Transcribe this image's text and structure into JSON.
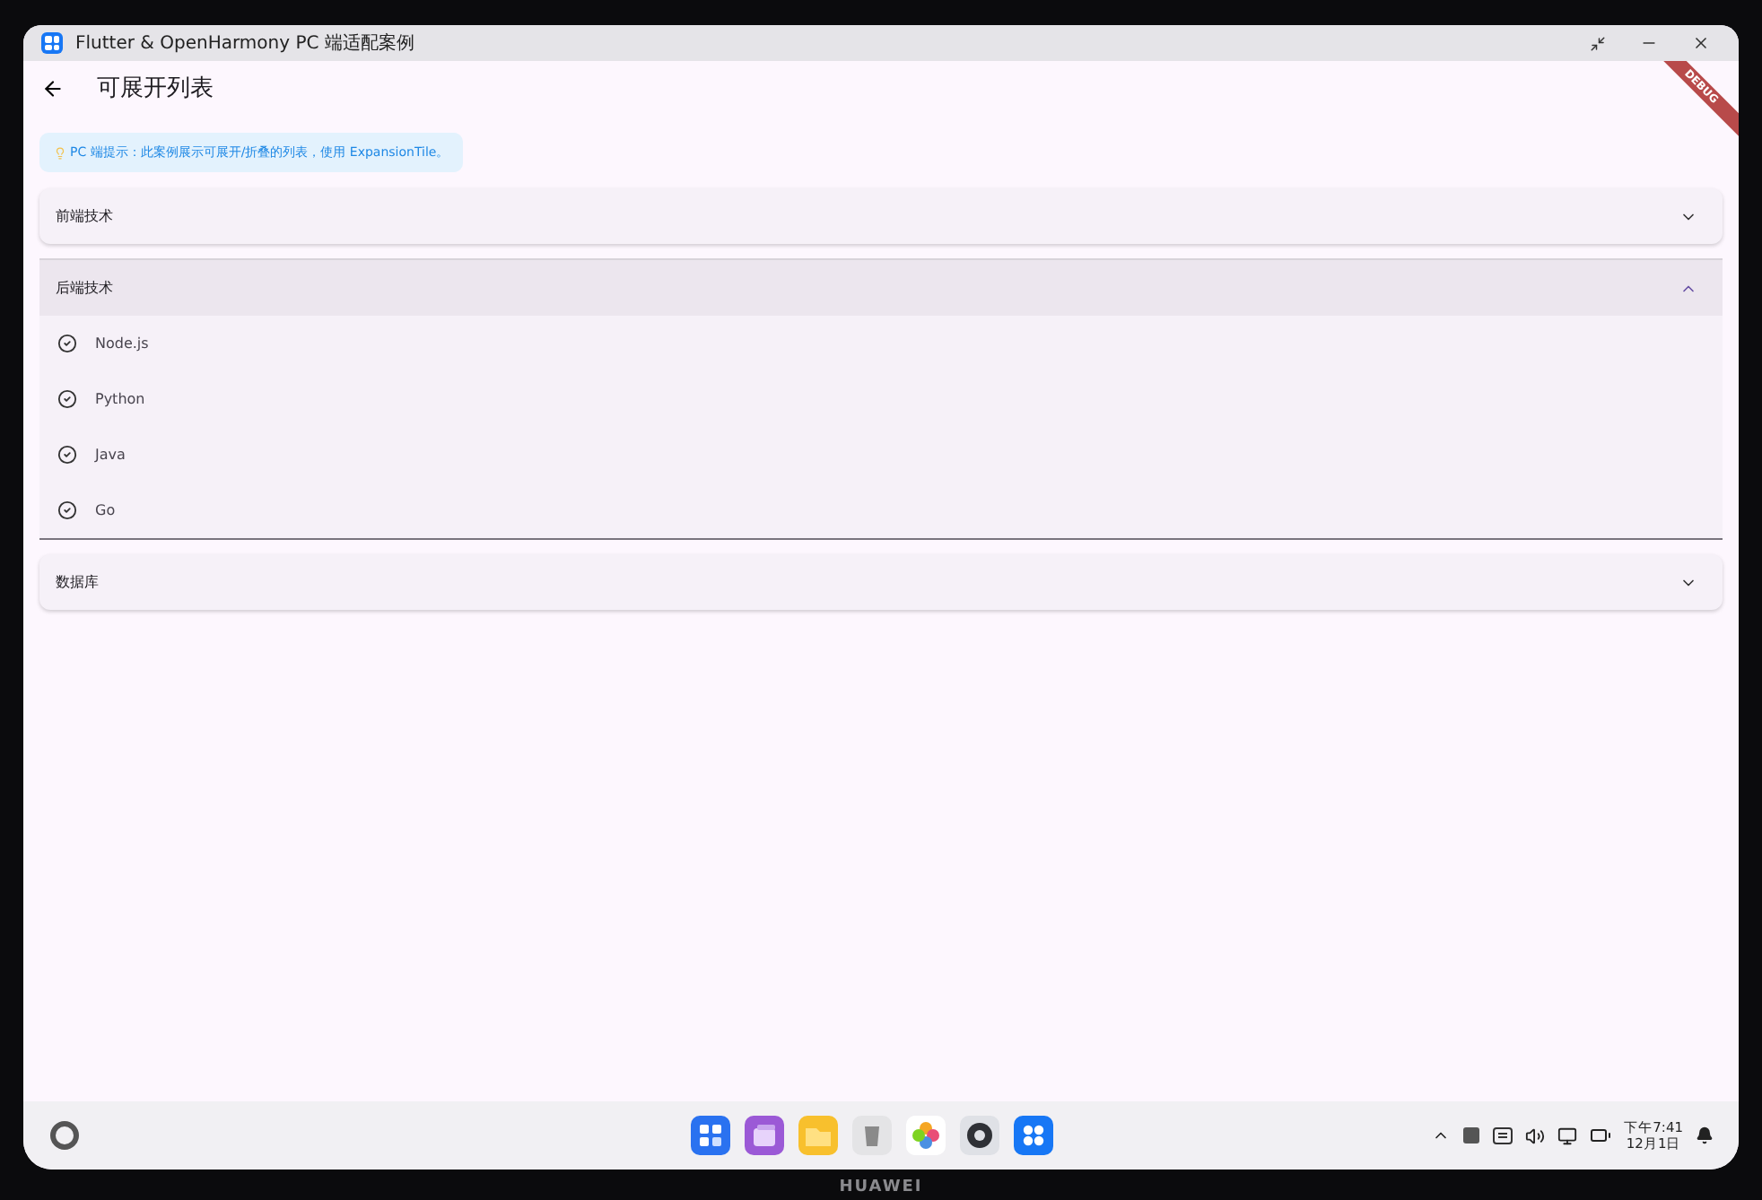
{
  "window": {
    "title": "Flutter & OpenHarmony PC 端适配案例"
  },
  "app_bar": {
    "title": "可展开列表",
    "debug_banner": "DEBUG"
  },
  "hint": {
    "text": "PC 端提示：此案例展示可展开/折叠的列表，使用 ExpansionTile。"
  },
  "panels": [
    {
      "title": "前端技术",
      "expanded": false
    },
    {
      "title": "后端技术",
      "expanded": true,
      "items": [
        {
          "label": "Node.js"
        },
        {
          "label": "Python"
        },
        {
          "label": "Java"
        },
        {
          "label": "Go"
        }
      ]
    },
    {
      "title": "数据库",
      "expanded": false
    }
  ],
  "taskbar": {
    "time": "下午7:41",
    "date": "12月1日"
  },
  "device": {
    "brand": "HUAWEI"
  }
}
